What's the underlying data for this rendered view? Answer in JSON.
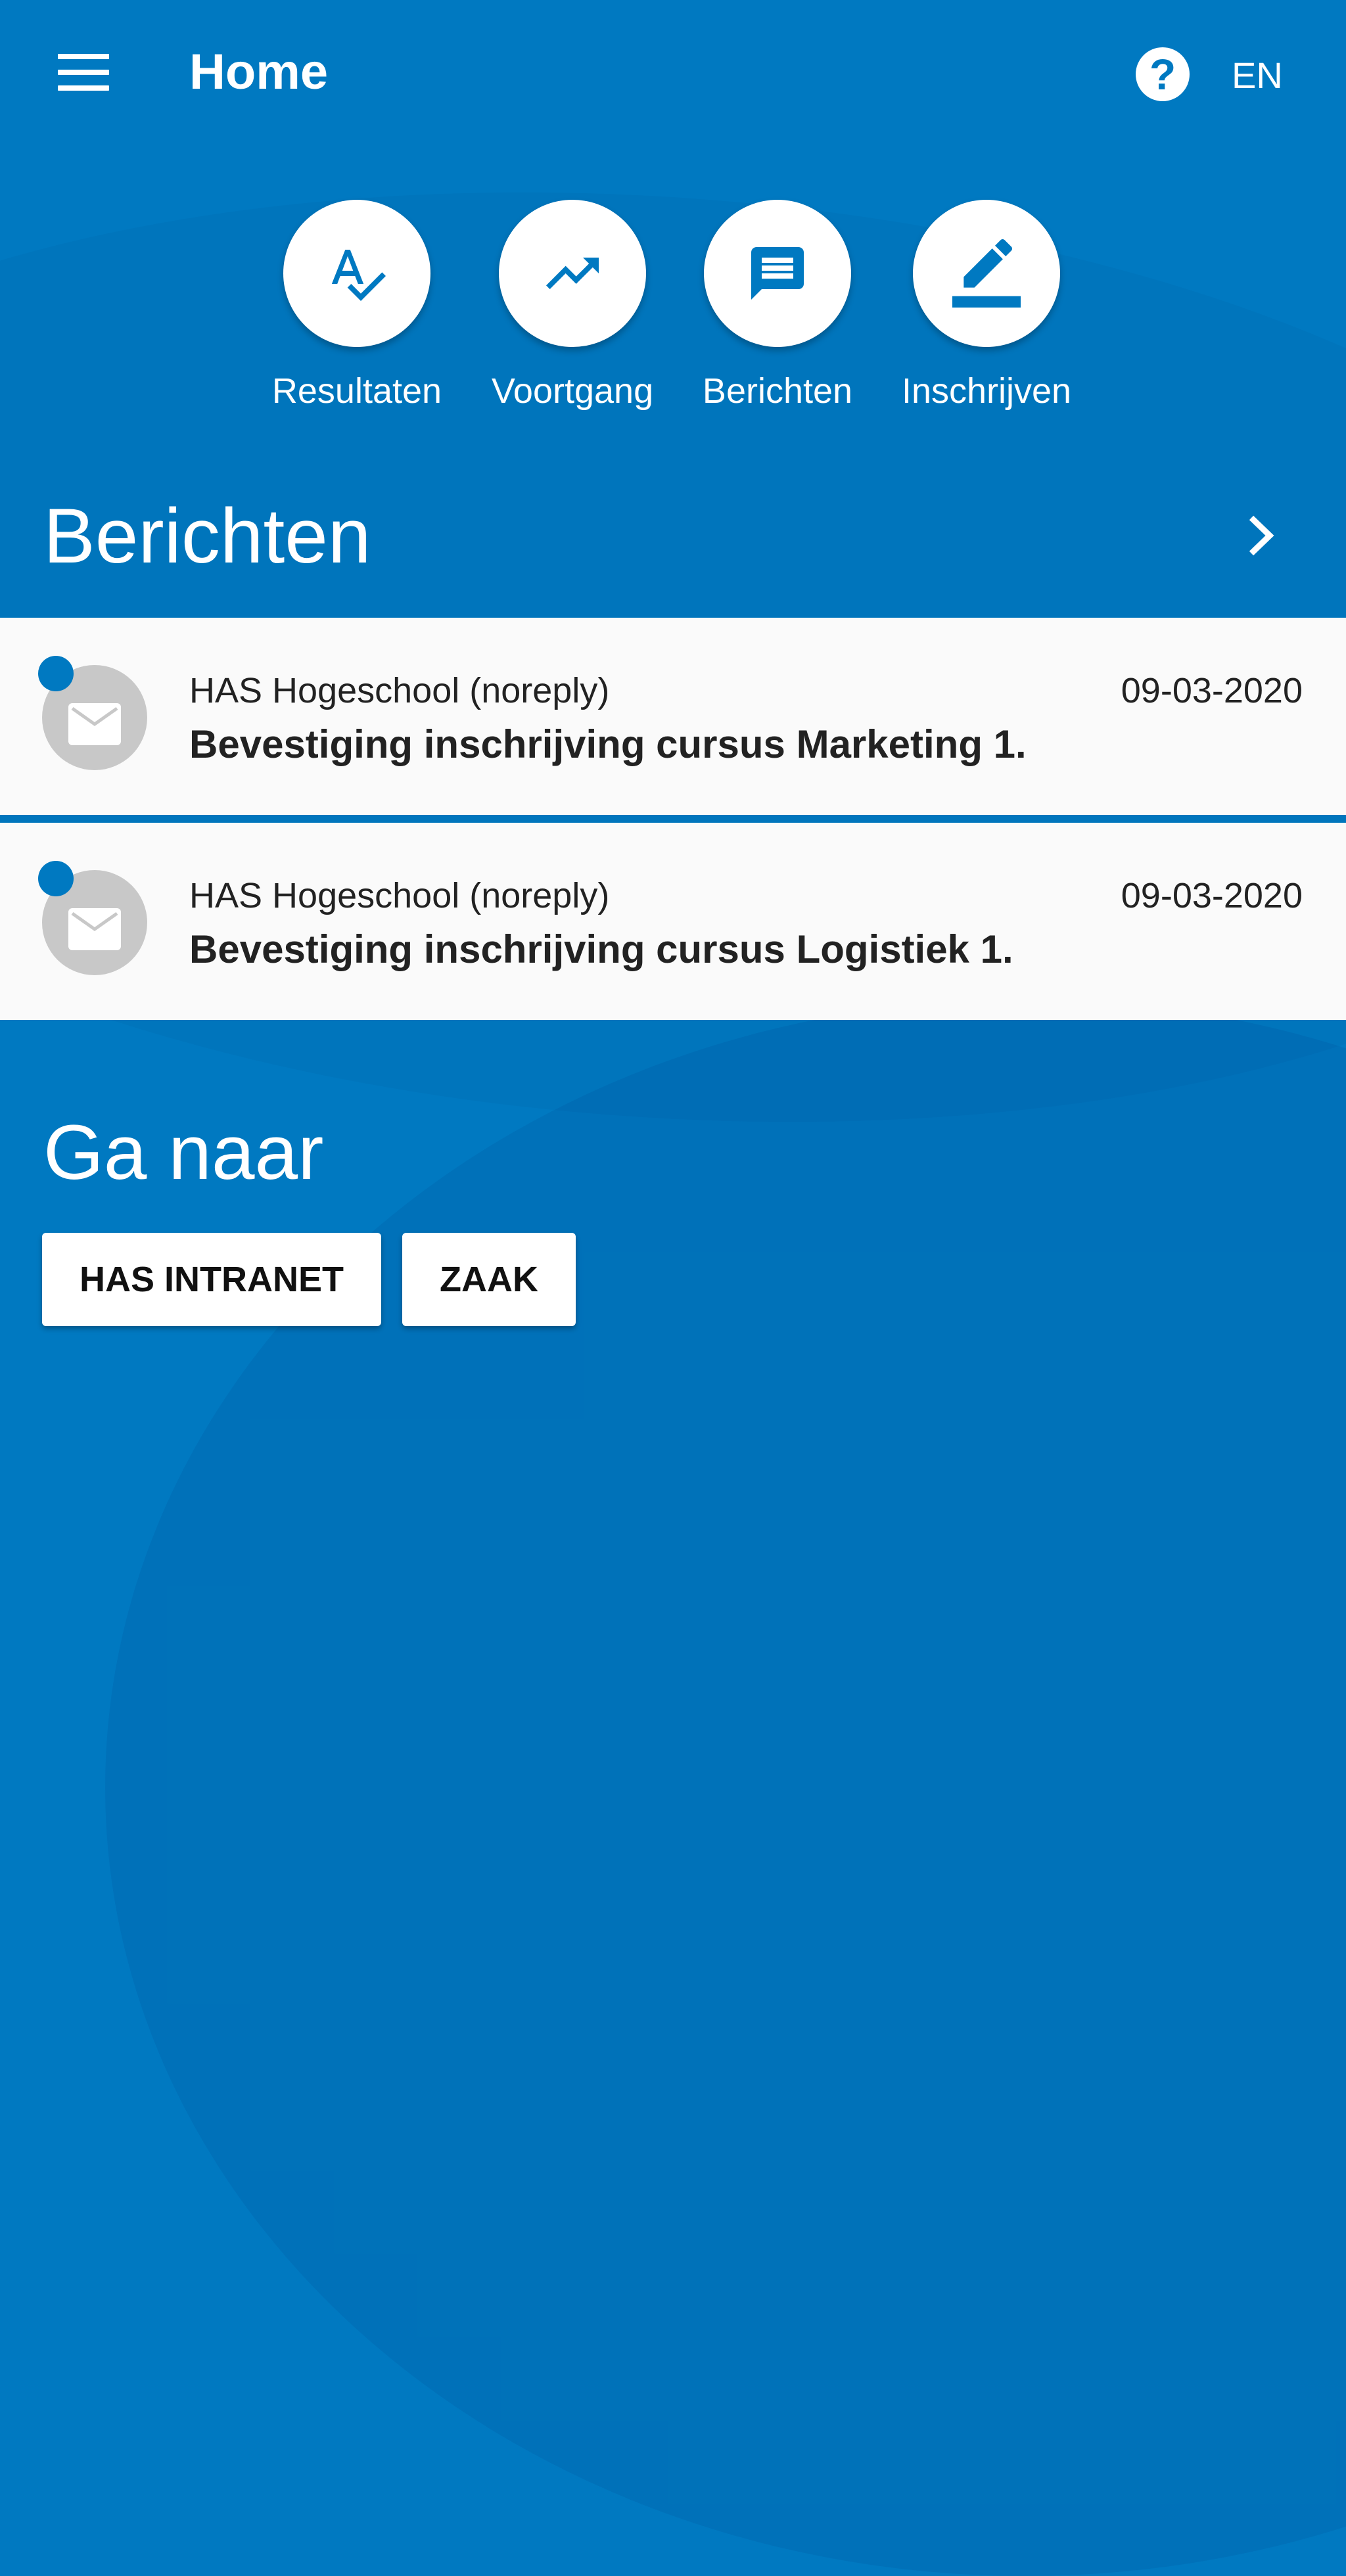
{
  "header": {
    "title": "Home",
    "language": "EN"
  },
  "quick_actions": [
    {
      "label": "Resultaten",
      "icon": "spellcheck-icon"
    },
    {
      "label": "Voortgang",
      "icon": "trending-up-icon"
    },
    {
      "label": "Berichten",
      "icon": "message-icon"
    },
    {
      "label": "Inschrijven",
      "icon": "edit-icon"
    }
  ],
  "messages_section": {
    "title": "Berichten",
    "items": [
      {
        "sender": "HAS Hogeschool (noreply)",
        "date": "09-03-2020",
        "subject": "Bevestiging inschrijving cursus Marketing 1.",
        "unread": true
      },
      {
        "sender": "HAS Hogeschool (noreply)",
        "date": "09-03-2020",
        "subject": "Bevestiging inschrijving cursus Logistiek 1.",
        "unread": true
      }
    ]
  },
  "goto_section": {
    "title": "Ga naar",
    "buttons": [
      "HAS INTRANET",
      "ZAAK"
    ]
  },
  "colors": {
    "primary": "#0079c1",
    "card": "#fafafa",
    "avatar": "#c8c8c8"
  }
}
